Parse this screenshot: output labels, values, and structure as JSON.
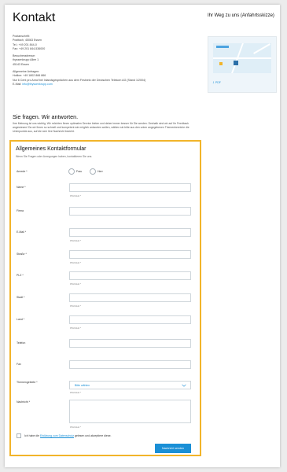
{
  "header": {
    "title": "Kontakt"
  },
  "address": {
    "block1": [
      "Postanschrift:",
      "Postfach, 45063 Essen",
      "Tel.: +49 201 844-0",
      "Fax: +49 201 844-536000"
    ],
    "block2": [
      "Besucheradresse:",
      "thyssenkrupp Allee 1",
      "45143 Essen"
    ],
    "block3": [
      "Allgemeine Anfragen:",
      "Hotline: +49 1802 866 866",
      "Nur 6 Cent pro Anruf bei Inlandsgesprächen aus dem Festnetz der Deutschen Telekom AG (Stand 1/2004)"
    ],
    "email_prefix": "E-Mail:",
    "email": "info@thyssenkrupp.com"
  },
  "sidebar": {
    "title": "Ihr Weg zu uns (Anfahrtsskizze)",
    "pdf_label": "PDF"
  },
  "section": {
    "title": "Sie fragen. Wir antworten.",
    "intro": "Ihre Meinung ist uns wichtig. Wir möchten Ihnen optimalen Service bieten und daher immer besser für Sie werden. Deshalb sind wir auf Ihr Feedback angewiesen! Da wir Ihnen so schnell und kompetent wie möglich antworten wollen, wählen sie bitte aus den unten angegebenen Themenbereiche die Unterpunkte aus, auf die sich Ihre Nachricht bezieht."
  },
  "form": {
    "title": "Allgemeines Kontaktformular",
    "subtitle": "Wenn Sie Fragen oder Anregungen haben, kontaktieren Sie uns.",
    "anrede_label": "Anrede *",
    "anrede_options": [
      "Frau",
      "Herr"
    ],
    "fields": [
      {
        "label": "Name *",
        "hint": "Pflichtfeld *"
      },
      {
        "label": "Firma",
        "hint": ""
      },
      {
        "label": "E-Mail *",
        "hint": "Pflichtfeld *"
      },
      {
        "label": "Straße *",
        "hint": "Pflichtfeld *"
      },
      {
        "label": "PLZ *",
        "hint": "Pflichtfeld *"
      },
      {
        "label": "Stadt *",
        "hint": "Pflichtfeld *"
      },
      {
        "label": "Land *",
        "hint": "Pflichtfeld *"
      },
      {
        "label": "Telefon",
        "hint": ""
      },
      {
        "label": "Fax",
        "hint": ""
      }
    ],
    "topic_label": "Themengebiete *",
    "topic_value": "Bitte wählen",
    "topic_hint": "Pflichtfeld *",
    "message_label": "Nachricht *",
    "message_hint": "Pflichtfeld *",
    "consent_pre": "Ich habe die ",
    "consent_link": "Erklärung zum Datenschutz",
    "consent_post": " gelesen und akzeptiere diese.",
    "submit_label": "Nachricht senden"
  },
  "colors": {
    "accent": "#1a8fd6",
    "highlight": "#f2b42a"
  }
}
